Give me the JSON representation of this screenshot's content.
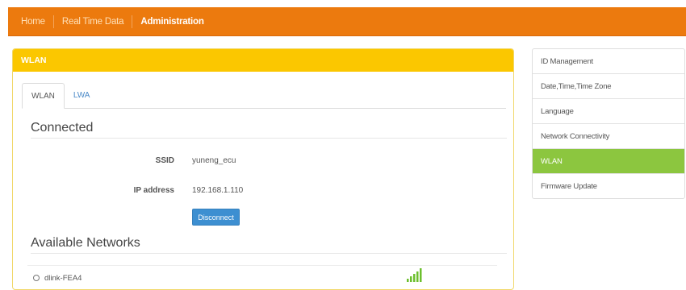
{
  "topnav": {
    "items": [
      {
        "label": "Home"
      },
      {
        "label": "Real Time Data"
      },
      {
        "label": "Administration"
      }
    ]
  },
  "panel": {
    "title": "WLAN",
    "tabs": [
      {
        "label": "WLAN",
        "active": true
      },
      {
        "label": "LWA",
        "active": false
      }
    ],
    "connected": {
      "heading": "Connected",
      "ssid_label": "SSID",
      "ssid_value": "yuneng_ecu",
      "ip_label": "IP address",
      "ip_value": "192.168.1.110",
      "disconnect_label": "Disconnect"
    },
    "available": {
      "heading": "Available Networks",
      "networks": [
        {
          "name": "dlink-FEA4",
          "signal_icon": "signal-bars-icon"
        }
      ]
    }
  },
  "sidemenu": {
    "items": [
      {
        "label": "ID Management"
      },
      {
        "label": "Date,Time,Time Zone"
      },
      {
        "label": "Language"
      },
      {
        "label": "Network Connectivity"
      },
      {
        "label": "WLAN",
        "active": true
      },
      {
        "label": "Firmware Update"
      }
    ]
  },
  "colors": {
    "nav_bg": "#ec7a0e",
    "panel_header": "#fbc700",
    "active_menu": "#8cc63f",
    "button": "#3d8fd1",
    "signal": "#6cbf2e"
  }
}
